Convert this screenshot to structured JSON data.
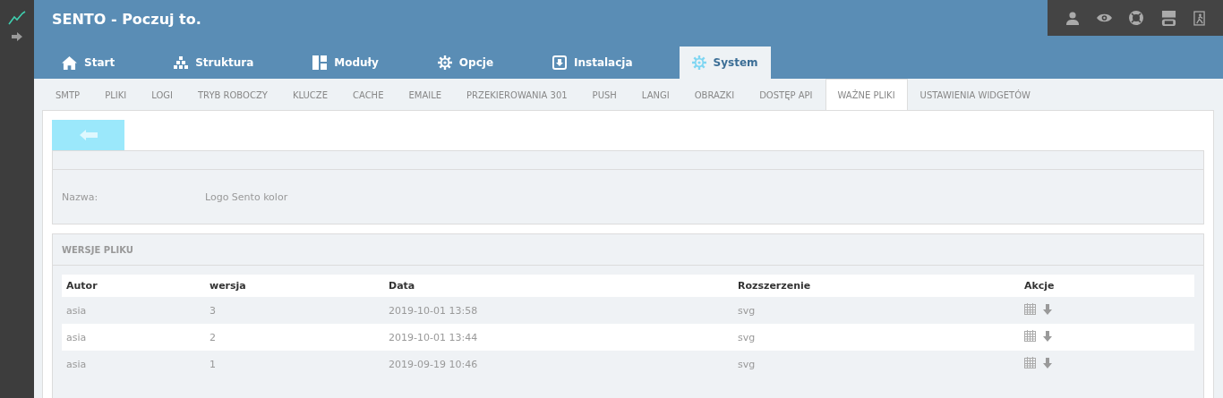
{
  "header": {
    "title": "SENTO - Poczuj to."
  },
  "main_tabs": [
    {
      "label": "Start",
      "selected": false
    },
    {
      "label": "Struktura",
      "selected": false
    },
    {
      "label": "Moduły",
      "selected": false
    },
    {
      "label": "Opcje",
      "selected": false
    },
    {
      "label": "Instalacja",
      "selected": false
    },
    {
      "label": "System",
      "selected": true
    }
  ],
  "sub_tabs": [
    {
      "label": "SMTP",
      "selected": false
    },
    {
      "label": "PLIKI",
      "selected": false
    },
    {
      "label": "LOGI",
      "selected": false
    },
    {
      "label": "TRYB ROBOCZY",
      "selected": false
    },
    {
      "label": "KLUCZE",
      "selected": false
    },
    {
      "label": "CACHE",
      "selected": false
    },
    {
      "label": "EMAILE",
      "selected": false
    },
    {
      "label": "PRZEKIEROWANIA 301",
      "selected": false
    },
    {
      "label": "PUSH",
      "selected": false
    },
    {
      "label": "LANGI",
      "selected": false
    },
    {
      "label": "OBRAZKI",
      "selected": false
    },
    {
      "label": "DOSTĘP API",
      "selected": false
    },
    {
      "label": "WAŻNE PLIKI",
      "selected": true
    },
    {
      "label": "USTAWIENIA WIDGETÓW",
      "selected": false
    }
  ],
  "details": {
    "label": "Nazwa:",
    "value": "Logo Sento kolor"
  },
  "versions": {
    "title": "WERSJE PLIKU",
    "columns": [
      "Autor",
      "wersja",
      "Data",
      "Rozszerzenie",
      "Akcje"
    ],
    "rows": [
      {
        "author": "asia",
        "version": "3",
        "date": "2019-10-01 13:58",
        "extension": "svg"
      },
      {
        "author": "asia",
        "version": "2",
        "date": "2019-10-01 13:44",
        "extension": "svg"
      },
      {
        "author": "asia",
        "version": "1",
        "date": "2019-09-19 10:46",
        "extension": "svg"
      }
    ]
  }
}
